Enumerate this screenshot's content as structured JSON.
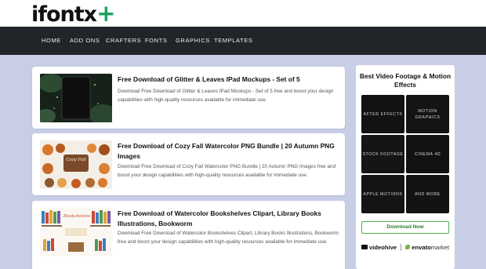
{
  "logo": {
    "text": "ifontx",
    "plus": "+"
  },
  "nav": [
    "HOME",
    "ADD ONS",
    "CRAFTERS",
    "FONTS",
    "GRAPHICS",
    "TEMPLATES"
  ],
  "posts": [
    {
      "title": "Free Download of Glitter & Leaves IPad Mockups - Set of 5",
      "desc": "Download Free Download of Glitter & Leaves IPad Mockups - Set of 5 free and boost your design capabilities with high-quality resources available for immediate use."
    },
    {
      "title": "Free Download of Cozy Fall Watercolor PNG Bundle | 20 Autumn PNG Images",
      "desc": "Download Free Download of Cozy Fall Watercolor PNG Bundle | 20 Autumn PNG Images free and boost your design capabilities with high-quality resources available for immediate use.",
      "thumb_text": "Cozy Fall"
    },
    {
      "title": "Free Download of Watercolor Bookshelves Clipart, Library Books Illustrations, Bookworm",
      "desc": "Download Free Download of Watercolor Bookshelves Clipart, Library Books Illustrations, Bookworm free and boost your design capabilities with high-quality resources available for immediate use.",
      "thumb_text": "Bookshelves"
    }
  ],
  "sidebar": {
    "title": "Best Video Footage & Motion Effects",
    "tiles": [
      "AFTER EFFECTS",
      "MOTION GRAPHICS",
      "STOCK FOOTAGE",
      "CINEMA 4D",
      "APPLE MOTIONS",
      "AND MORE"
    ],
    "button": "Download Now",
    "partner1": "videohive",
    "partner2_a": "envato",
    "partner2_b": "market"
  },
  "colors": {
    "nav_bg": "#212529",
    "page_bg": "#c7cee6",
    "accent_green": "#18a35a"
  }
}
